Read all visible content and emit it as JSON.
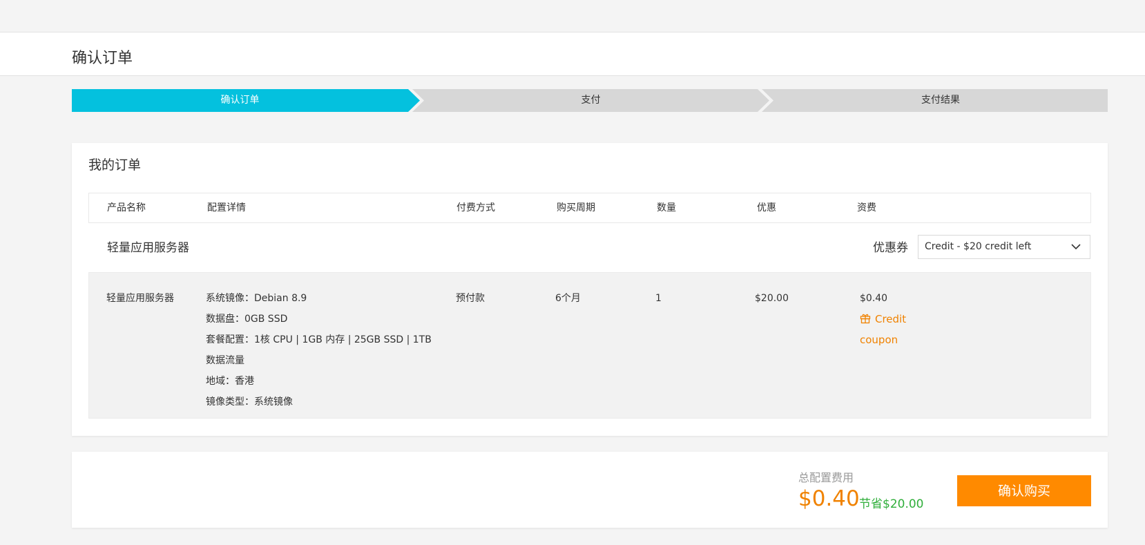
{
  "page": {
    "title": "确认订单"
  },
  "steps": [
    {
      "label": "确认订单",
      "active": true
    },
    {
      "label": "支付",
      "active": false
    },
    {
      "label": "支付结果",
      "active": false
    }
  ],
  "colors": {
    "active_step": "#04c1de",
    "inactive_step": "#d7d7d7",
    "accent": "#ff8a00",
    "saving": "#2fae3a"
  },
  "order": {
    "title": "我的订单",
    "columns": [
      "产品名称",
      "配置详情",
      "付费方式",
      "购买周期",
      "数量",
      "优惠",
      "资费"
    ],
    "product_group": "轻量应用服务器",
    "coupon": {
      "label": "优惠券",
      "selected": "Credit - $20 credit left"
    },
    "row": {
      "product": "轻量应用服务器",
      "details": [
        "系统镜像：Debian 8.9",
        "数据盘：0GB SSD",
        "套餐配置：1核 CPU | 1GB 内存 | 25GB SSD | 1TB",
        "数据流量",
        "地域：香港",
        "镜像类型：系统镜像"
      ],
      "payment": "预付款",
      "period": "6个月",
      "quantity": "1",
      "discount": "$20.00",
      "price": "$0.40",
      "discount_link": "Credit coupon",
      "discount_icon": "gift-icon"
    }
  },
  "footer": {
    "total_label": "总配置费用",
    "total_price": "$0.40",
    "savings": "节省$20.00",
    "buy_label": "确认购买"
  }
}
